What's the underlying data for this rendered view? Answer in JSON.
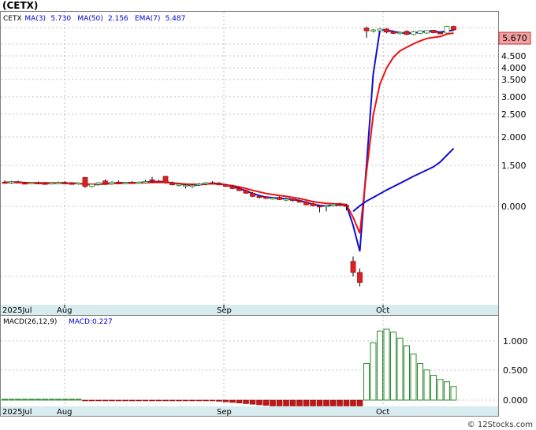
{
  "header": {
    "ticker": "(CETX)",
    "legend": [
      {
        "name": "CETX",
        "value": "",
        "color": "#000000"
      },
      {
        "name": "MA(3)",
        "value": "5.730",
        "color": "#0000cc"
      },
      {
        "name": "MA(50)",
        "value": "2.156",
        "color": "#0000cc"
      },
      {
        "name": "EMA(7)",
        "value": "5.487",
        "color": "#0000cc"
      }
    ],
    "last_price": "5.670"
  },
  "macd": {
    "label": "MACD(26,12,9)",
    "value_label": "MACD:0.227",
    "ticks": [
      "1.000",
      "0.500",
      "0.000"
    ]
  },
  "footer": {
    "copyright": "© 12Stocks.com"
  },
  "colors": {
    "up": "#ffffff",
    "down": "#e02020",
    "ma_fast": "#1010cc",
    "ema": "#ee1010",
    "ma_slow": "#1010cc",
    "macd_bar": "#2a8a2a",
    "month_band": "#d8ecef",
    "grid": "#b0b0b0"
  },
  "chart_data": [
    {
      "type": "candlestick",
      "title": "(CETX)",
      "x_labels": [
        "2025Jul",
        "Aug",
        "Sep",
        "Oct"
      ],
      "y_ticks": [
        "4.500",
        "4.000",
        "3.500",
        "3.000",
        "2.500",
        "2.000",
        "1.500",
        "0.000"
      ],
      "ylim": [
        0,
        6.2
      ],
      "candles": [
        {
          "o": 0.92,
          "h": 0.98,
          "l": 0.86,
          "c": 0.9
        },
        {
          "o": 0.9,
          "h": 0.96,
          "l": 0.85,
          "c": 0.93
        },
        {
          "o": 0.93,
          "h": 0.97,
          "l": 0.88,
          "c": 0.89
        },
        {
          "o": 0.89,
          "h": 0.93,
          "l": 0.85,
          "c": 0.87
        },
        {
          "o": 0.87,
          "h": 0.92,
          "l": 0.84,
          "c": 0.9
        },
        {
          "o": 0.9,
          "h": 0.94,
          "l": 0.86,
          "c": 0.88
        },
        {
          "o": 0.88,
          "h": 0.92,
          "l": 0.85,
          "c": 0.87
        },
        {
          "o": 0.87,
          "h": 0.91,
          "l": 0.84,
          "c": 0.89
        },
        {
          "o": 0.89,
          "h": 0.94,
          "l": 0.86,
          "c": 0.9
        },
        {
          "o": 0.9,
          "h": 0.95,
          "l": 0.86,
          "c": 0.88
        },
        {
          "o": 0.88,
          "h": 0.92,
          "l": 0.84,
          "c": 0.86
        },
        {
          "o": 0.86,
          "h": 0.9,
          "l": 0.82,
          "c": 0.89
        },
        {
          "o": 1.08,
          "h": 1.1,
          "l": 0.7,
          "c": 0.76
        },
        {
          "o": 0.76,
          "h": 0.86,
          "l": 0.72,
          "c": 0.84
        },
        {
          "o": 0.84,
          "h": 0.92,
          "l": 0.8,
          "c": 0.9
        },
        {
          "o": 0.96,
          "h": 1.02,
          "l": 0.82,
          "c": 0.86
        },
        {
          "o": 0.86,
          "h": 0.95,
          "l": 0.82,
          "c": 0.92
        },
        {
          "o": 0.92,
          "h": 0.98,
          "l": 0.86,
          "c": 0.88
        },
        {
          "o": 0.88,
          "h": 0.93,
          "l": 0.84,
          "c": 0.91
        },
        {
          "o": 0.91,
          "h": 0.96,
          "l": 0.86,
          "c": 0.89
        },
        {
          "o": 0.89,
          "h": 0.94,
          "l": 0.85,
          "c": 0.92
        },
        {
          "o": 0.92,
          "h": 1.0,
          "l": 0.88,
          "c": 0.94
        },
        {
          "o": 1.0,
          "h": 1.1,
          "l": 0.9,
          "c": 0.95
        },
        {
          "o": 0.95,
          "h": 1.0,
          "l": 0.9,
          "c": 0.93
        },
        {
          "o": 1.12,
          "h": 1.14,
          "l": 0.86,
          "c": 0.9
        },
        {
          "o": 0.9,
          "h": 0.94,
          "l": 0.8,
          "c": 0.82
        },
        {
          "o": 0.82,
          "h": 0.88,
          "l": 0.76,
          "c": 0.84
        },
        {
          "o": 0.78,
          "h": 0.86,
          "l": 0.68,
          "c": 0.8
        },
        {
          "o": 0.76,
          "h": 0.84,
          "l": 0.7,
          "c": 0.8
        },
        {
          "o": 0.82,
          "h": 0.9,
          "l": 0.78,
          "c": 0.86
        },
        {
          "o": 0.86,
          "h": 0.92,
          "l": 0.8,
          "c": 0.9
        },
        {
          "o": 0.9,
          "h": 0.95,
          "l": 0.84,
          "c": 0.88
        },
        {
          "o": 0.88,
          "h": 0.92,
          "l": 0.8,
          "c": 0.82
        },
        {
          "o": 0.82,
          "h": 0.86,
          "l": 0.74,
          "c": 0.76
        },
        {
          "o": 0.76,
          "h": 0.8,
          "l": 0.66,
          "c": 0.68
        },
        {
          "o": 0.68,
          "h": 0.72,
          "l": 0.58,
          "c": 0.6
        },
        {
          "o": 0.6,
          "h": 0.64,
          "l": 0.48,
          "c": 0.5
        },
        {
          "o": 0.5,
          "h": 0.54,
          "l": 0.36,
          "c": 0.38
        },
        {
          "o": 0.38,
          "h": 0.4,
          "l": 0.3,
          "c": 0.36
        },
        {
          "o": 0.36,
          "h": 0.38,
          "l": 0.28,
          "c": 0.3
        },
        {
          "o": 0.3,
          "h": 0.34,
          "l": 0.26,
          "c": 0.32
        },
        {
          "o": 0.34,
          "h": 0.38,
          "l": 0.24,
          "c": 0.26
        },
        {
          "o": 0.26,
          "h": 0.32,
          "l": 0.2,
          "c": 0.28
        },
        {
          "o": 0.28,
          "h": 0.3,
          "l": 0.18,
          "c": 0.22
        },
        {
          "o": 0.22,
          "h": 0.26,
          "l": 0.14,
          "c": 0.16
        },
        {
          "o": 0.16,
          "h": 0.2,
          "l": 0.04,
          "c": 0.06
        },
        {
          "o": 0.1,
          "h": 0.14,
          "l": 0.0,
          "c": 0.02
        },
        {
          "o": 0.02,
          "h": 0.06,
          "l": -0.06,
          "c": 0.0
        },
        {
          "o": 0.0,
          "h": 0.04,
          "l": -0.05,
          "c": 0.03
        },
        {
          "o": 0.03,
          "h": 0.12,
          "l": 0.0,
          "c": 0.08
        },
        {
          "o": 0.08,
          "h": 0.14,
          "l": 0.02,
          "c": 0.04
        },
        {
          "o": 0.04,
          "h": 0.08,
          "l": -0.04,
          "c": 0.0
        },
        {
          "o": -0.55,
          "h": -0.5,
          "l": -0.7,
          "c": -0.66
        },
        {
          "o": -0.66,
          "h": -0.62,
          "l": -0.8,
          "c": -0.76
        },
        {
          "o": 6.1,
          "h": 6.2,
          "l": 5.55,
          "c": 5.95
        },
        {
          "o": 5.95,
          "h": 6.05,
          "l": 5.85,
          "c": 6.0
        },
        {
          "o": 5.95,
          "h": 6.1,
          "l": 5.85,
          "c": 6.05
        },
        {
          "o": 6.05,
          "h": 6.1,
          "l": 5.8,
          "c": 5.88
        },
        {
          "o": 5.9,
          "h": 5.98,
          "l": 5.76,
          "c": 5.8
        },
        {
          "o": 5.8,
          "h": 5.9,
          "l": 5.74,
          "c": 5.85
        },
        {
          "o": 5.92,
          "h": 5.98,
          "l": 5.7,
          "c": 5.74
        },
        {
          "o": 5.74,
          "h": 5.95,
          "l": 5.7,
          "c": 5.9
        },
        {
          "o": 5.8,
          "h": 5.98,
          "l": 5.76,
          "c": 5.95
        },
        {
          "o": 5.82,
          "h": 5.98,
          "l": 5.78,
          "c": 5.96
        },
        {
          "o": 5.98,
          "h": 6.0,
          "l": 5.8,
          "c": 5.84
        },
        {
          "o": 5.84,
          "h": 5.9,
          "l": 5.76,
          "c": 5.8
        },
        {
          "o": 5.82,
          "h": 6.24,
          "l": 5.8,
          "c": 6.2
        },
        {
          "o": 6.2,
          "h": 6.24,
          "l": 5.96,
          "c": 6.0
        }
      ],
      "series": [
        {
          "name": "MA(3)",
          "values": [
            0.91,
            0.92,
            0.92,
            0.9,
            0.89,
            0.88,
            0.88,
            0.88,
            0.89,
            0.89,
            0.88,
            0.88,
            0.84,
            0.83,
            0.83,
            0.87,
            0.88,
            0.89,
            0.9,
            0.89,
            0.9,
            0.92,
            0.93,
            0.94,
            0.93,
            0.89,
            0.86,
            0.82,
            0.81,
            0.82,
            0.85,
            0.88,
            0.87,
            0.82,
            0.75,
            0.68,
            0.59,
            0.49,
            0.41,
            0.35,
            0.33,
            0.3,
            0.29,
            0.26,
            0.22,
            0.15,
            0.08,
            0.03,
            0.02,
            0.04,
            0.05,
            0.04,
            -0.19,
            -0.45,
            1.51,
            3.73,
            6.0,
            5.98,
            5.91,
            5.84,
            5.8,
            5.83,
            5.86,
            5.93,
            5.92,
            5.87,
            5.93,
            5.99
          ]
        },
        {
          "name": "EMA(7)",
          "values": [
            0.91,
            0.91,
            0.91,
            0.9,
            0.9,
            0.89,
            0.89,
            0.89,
            0.89,
            0.89,
            0.88,
            0.88,
            0.85,
            0.84,
            0.85,
            0.85,
            0.87,
            0.87,
            0.88,
            0.89,
            0.89,
            0.9,
            0.91,
            0.91,
            0.91,
            0.89,
            0.87,
            0.85,
            0.84,
            0.84,
            0.85,
            0.86,
            0.85,
            0.82,
            0.79,
            0.74,
            0.68,
            0.61,
            0.55,
            0.49,
            0.45,
            0.41,
            0.38,
            0.34,
            0.3,
            0.24,
            0.18,
            0.14,
            0.11,
            0.1,
            0.09,
            0.07,
            -0.11,
            -0.27,
            1.28,
            2.48,
            3.37,
            3.99,
            4.44,
            4.79,
            5.0,
            5.2,
            5.37,
            5.51,
            5.57,
            5.62,
            5.76,
            5.82
          ]
        },
        {
          "name": "MA(50)",
          "values": [
            null,
            null,
            null,
            null,
            null,
            null,
            null,
            null,
            null,
            null,
            null,
            null,
            null,
            null,
            null,
            null,
            null,
            null,
            null,
            null,
            null,
            null,
            null,
            null,
            null,
            null,
            null,
            null,
            null,
            null,
            null,
            null,
            null,
            null,
            null,
            null,
            null,
            null,
            null,
            null,
            null,
            null,
            null,
            null,
            null,
            null,
            null,
            null,
            null,
            null,
            null,
            null,
            -0.05,
            0.02,
            0.2,
            0.34,
            0.48,
            0.62,
            0.75,
            0.88,
            1.0,
            1.12,
            1.23,
            1.34,
            1.45,
            1.56,
            1.68,
            1.8
          ]
        }
      ]
    },
    {
      "type": "bar",
      "title": "MACD(26,12,9)",
      "ylim": [
        -0.1,
        1.3
      ],
      "values": [
        0,
        0,
        0,
        0,
        0,
        0,
        0,
        0,
        0,
        0,
        0,
        0,
        -0.01,
        -0.01,
        -0.01,
        -0.01,
        -0.01,
        -0.01,
        -0.01,
        -0.01,
        -0.01,
        -0.01,
        -0.01,
        -0.01,
        -0.01,
        -0.01,
        -0.01,
        -0.01,
        -0.01,
        -0.01,
        -0.01,
        -0.01,
        -0.02,
        -0.03,
        -0.04,
        -0.05,
        -0.06,
        -0.07,
        -0.08,
        -0.09,
        -0.1,
        -0.1,
        -0.1,
        -0.1,
        -0.1,
        -0.1,
        -0.1,
        -0.1,
        -0.1,
        -0.1,
        -0.1,
        -0.1,
        -0.1,
        -0.1,
        0.62,
        0.97,
        1.17,
        1.2,
        1.15,
        1.05,
        0.92,
        0.78,
        0.62,
        0.51,
        0.42,
        0.35,
        0.31,
        0.23
      ]
    }
  ]
}
